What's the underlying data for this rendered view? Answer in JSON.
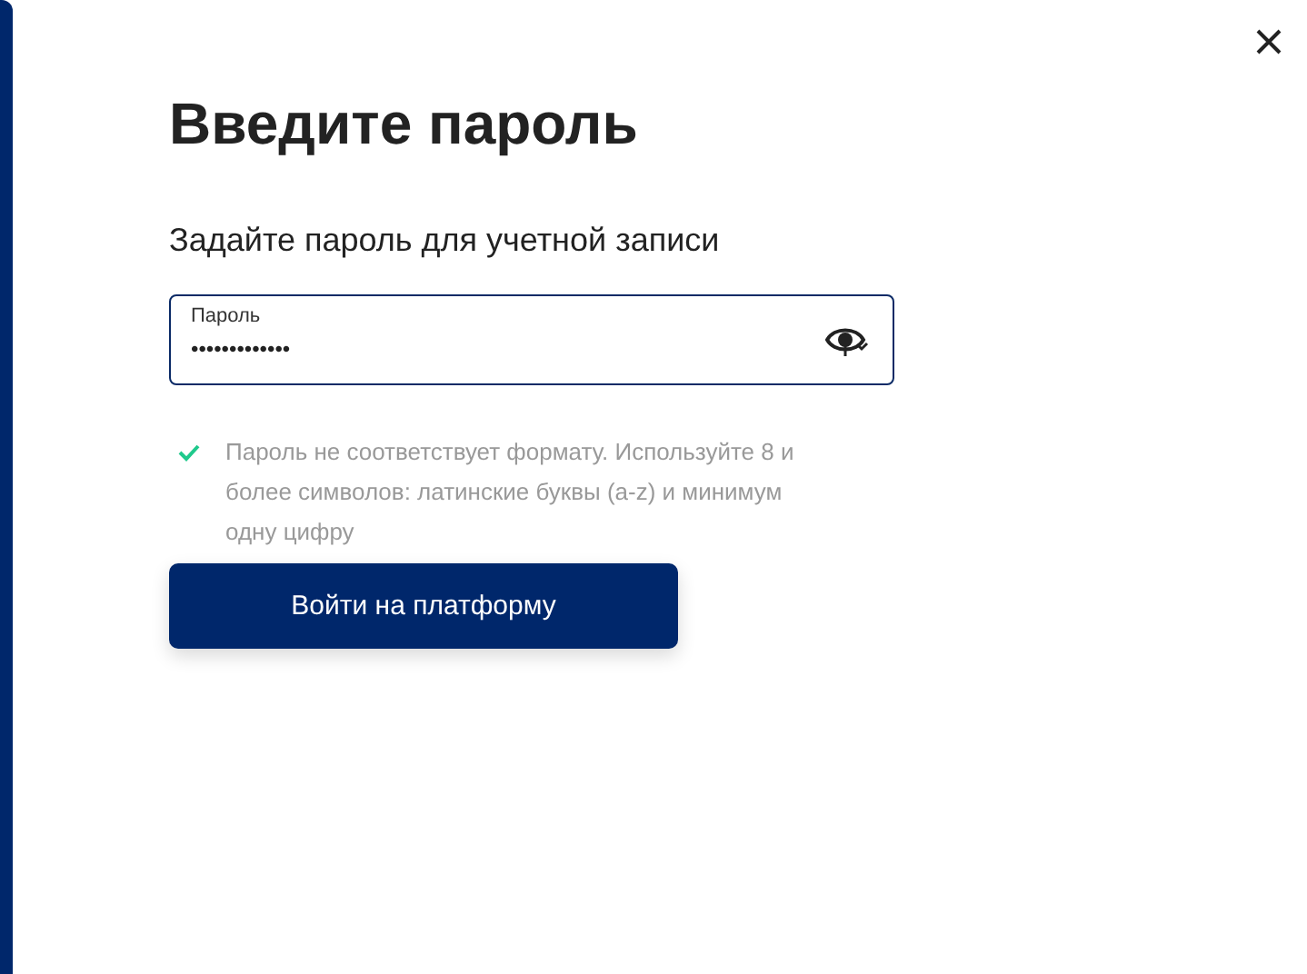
{
  "title": "Введите пароль",
  "subtitle": "Задайте пароль для учетной записи",
  "password_field": {
    "label": "Пароль",
    "value": "•••••••••••••"
  },
  "hint": {
    "met": true,
    "text": "Пароль не соответствует формату. Используйте 8 и более символов: латинские буквы (a-z) и минимум одну цифру"
  },
  "button": "Войти на платформу"
}
